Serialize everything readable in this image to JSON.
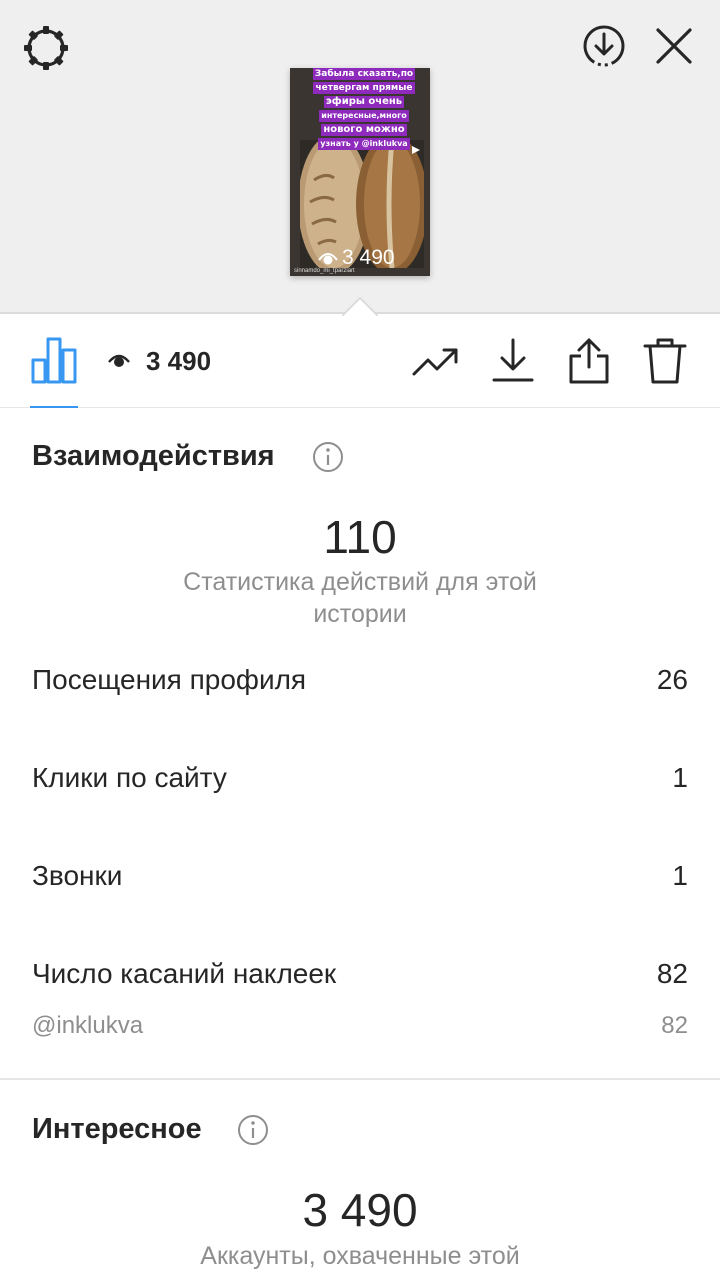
{
  "story_thumbnail": {
    "text_lines": [
      "Забыла сказать,по",
      "четвергам прямые",
      "эфиры очень",
      "интересные,много",
      "нового можно",
      "узнать у @inklukva"
    ],
    "views": "3 490",
    "watermark": "sinnamdo_mi_tparziart"
  },
  "toolbar": {
    "views": "3 490"
  },
  "interactions": {
    "title": "Взаимодействия",
    "total": "110",
    "caption": "Статистика действий для этой истории",
    "rows": [
      {
        "label": "Посещения профиля",
        "value": "26"
      },
      {
        "label": "Клики по сайту",
        "value": "1"
      },
      {
        "label": "Звонки",
        "value": "1"
      },
      {
        "label": "Число касаний наклеек",
        "value": "82"
      }
    ],
    "sticker_sub": {
      "label": "@inklukva",
      "value": "82"
    }
  },
  "discovery": {
    "title": "Интересное",
    "total": "3 490",
    "caption": "Аккаунты, охваченные этой"
  },
  "colors": {
    "accent": "#3897f0",
    "story_text_bg": "#8e2bbd",
    "gray_text": "#8e8e8e",
    "top_bg": "#efefef"
  },
  "icons": [
    "gear-icon",
    "download-circle-icon",
    "close-icon",
    "bar-chart-icon",
    "eye-icon",
    "trend-icon",
    "download-icon",
    "share-icon",
    "trash-icon",
    "info-icon"
  ]
}
